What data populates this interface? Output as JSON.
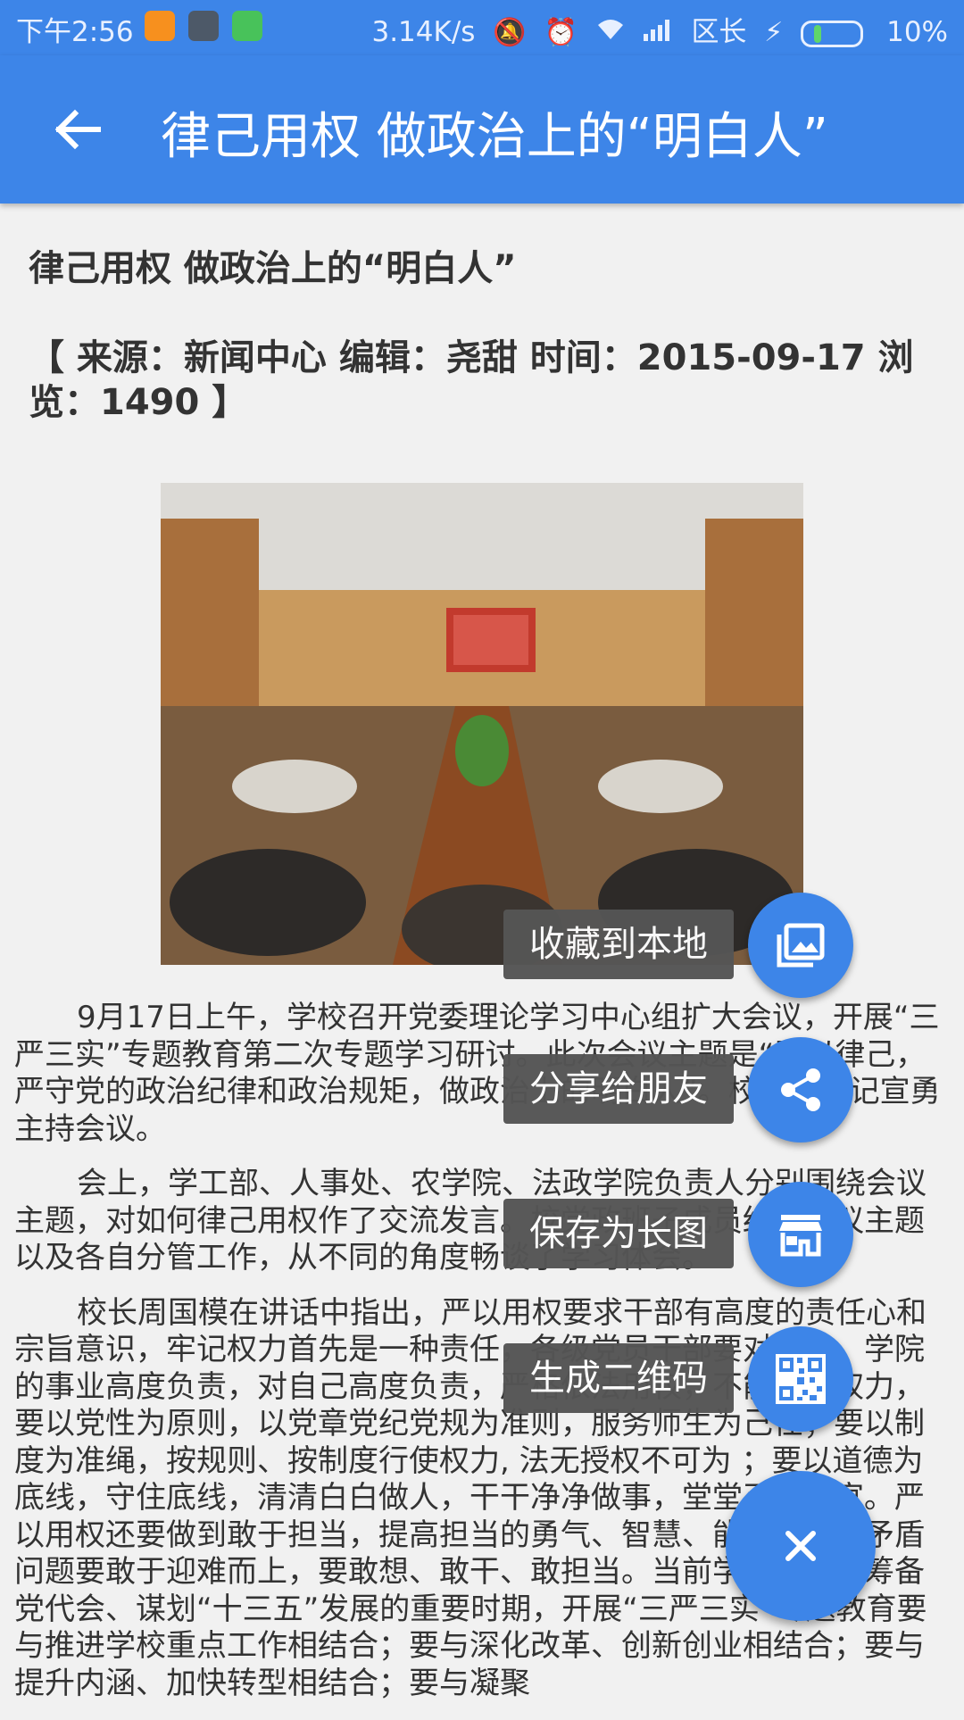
{
  "status_bar": {
    "time": "下午2:56",
    "net_speed": "3.14K/s",
    "carrier": "区长",
    "battery": "10%",
    "icons": [
      "uc-browser-icon",
      "app-icon",
      "android-icon",
      "mute-icon",
      "alarm-icon",
      "wifi-icon",
      "signal-icon",
      "charging-icon",
      "battery-icon"
    ]
  },
  "app_bar": {
    "title": "律己用权  做政治上的“明白人”",
    "back_icon": "arrow-left-icon"
  },
  "article": {
    "title": "律己用权 做政治上的“明白人”",
    "meta": "【 来源：新闻中心 编辑：尧甜 时间：2015-09-17 浏览：1490 】",
    "photo_alt": "meeting-room-photo",
    "paragraphs": [
      "9月17日上午，学校召开党委理论学习中心组扩大会议，开展“三严三实”专题教育第二次专题学习研讨。此次会议主题是“严以律己，严守党的政治纪律和政治规矩，做政治上的明白人”。校党委书记宣勇主持会议。",
      "会上，学工部、人事处、农学院、法政学院负责人分别围绕会议主题，对如何律己用权作了交流发言。校党政班子成员结合会议主题以及各自分管工作，从不同的角度畅谈了学习体会。",
      "校长周国模在讲话中指出，严以用权要求干部有高度的责任心和宗旨意识，牢记权力首先是一种责任，各级党员干部要对学校、学院的事业高度负责，对自己高度负责，严格依法用权，不能滥用权力，要以党性为原则，以党章党纪党规为准则，服务师生为己任；要以制度为准绳，按规则、按制度行使权力, 法无授权不可为 ；要以道德为底线，守住底线，清清白白做人，干干净净做事，堂堂正正做官。严以用权还要做到敢于担当，提高担当的勇气、智慧、能力，面对矛盾问题要敢于迎难而上，要敢想、敢干、敢担当。当前学校正处于筹备党代会、谋划“十三五”发展的重要时期，开展“三严三实”专题教育要与推进学校重点工作相结合；要与深化改革、创新创业相结合；要与提升内涵、加快转型相结合；要与凝聚"
    ]
  },
  "fab_menu": {
    "items": [
      {
        "label": "收藏到本地",
        "icon": "image-icon"
      },
      {
        "label": "分享给朋友",
        "icon": "share-icon"
      },
      {
        "label": "保存为长图",
        "icon": "store-icon"
      },
      {
        "label": "生成二维码",
        "icon": "qr-code-icon"
      }
    ],
    "close_icon": "close-icon",
    "accent": "#3d85e8"
  }
}
